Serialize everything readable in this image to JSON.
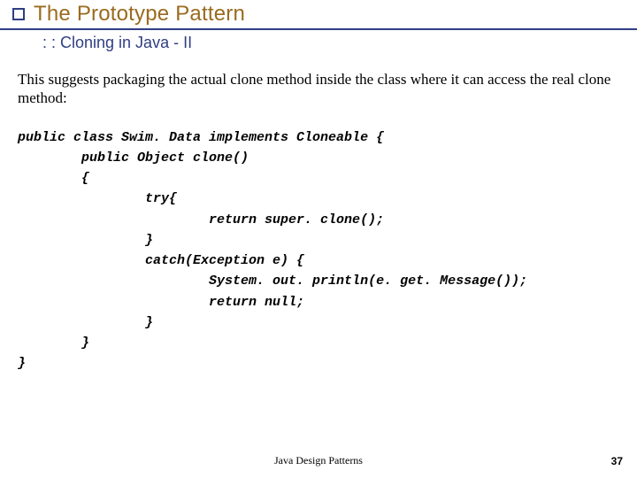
{
  "header": {
    "title": "The Prototype Pattern",
    "subtitle": ": : Cloning in Java - II"
  },
  "body": {
    "paragraph": "This suggests packaging the actual clone method inside the class where it can access the real clone method:"
  },
  "code": {
    "line1": "public class Swim. Data implements Cloneable {",
    "line2": "        public Object clone()",
    "line3": "        {",
    "line4": "                try{",
    "line5": "                        return super. clone();",
    "line6": "                }",
    "line7": "                catch(Exception e) {",
    "line8": "                        System. out. println(e. get. Message());",
    "line9": "                        return null;",
    "line10": "                }",
    "line11": "        }",
    "line12": "}"
  },
  "footer": {
    "center": "Java Design Patterns",
    "page": "37"
  }
}
